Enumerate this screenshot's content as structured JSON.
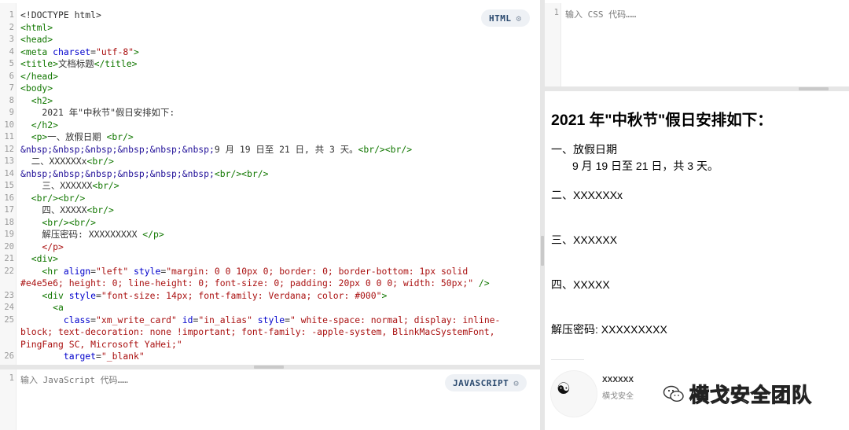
{
  "html_editor": {
    "badge": "HTML",
    "lines": [
      {
        "n": "1",
        "segs": [
          {
            "t": "<!DOCTYPE html>",
            "c": "t-txt"
          }
        ]
      },
      {
        "n": "2",
        "segs": [
          {
            "t": "<html>",
            "c": "t-tag"
          }
        ]
      },
      {
        "n": "3",
        "segs": [
          {
            "t": "<head>",
            "c": "t-tag"
          }
        ]
      },
      {
        "n": "4",
        "segs": [
          {
            "t": "<meta ",
            "c": "t-tag"
          },
          {
            "t": "charset",
            "c": "t-attr"
          },
          {
            "t": "=",
            "c": "t-txt"
          },
          {
            "t": "\"utf-8\"",
            "c": "t-str"
          },
          {
            "t": ">",
            "c": "t-tag"
          }
        ]
      },
      {
        "n": "5",
        "segs": [
          {
            "t": "<title>",
            "c": "t-tag"
          },
          {
            "t": "文档标题",
            "c": "t-txt"
          },
          {
            "t": "</title>",
            "c": "t-tag"
          }
        ]
      },
      {
        "n": "6",
        "segs": [
          {
            "t": "</head>",
            "c": "t-tag"
          }
        ]
      },
      {
        "n": "7",
        "segs": [
          {
            "t": "<body>",
            "c": "t-tag"
          }
        ]
      },
      {
        "n": "8",
        "segs": [
          {
            "t": "  <h2>",
            "c": "t-tag"
          }
        ]
      },
      {
        "n": "9",
        "segs": [
          {
            "t": "    2021 年\"中秋节\"假日安排如下:",
            "c": "t-txt"
          }
        ]
      },
      {
        "n": "10",
        "segs": [
          {
            "t": "  </h2>",
            "c": "t-tag"
          }
        ]
      },
      {
        "n": "11",
        "segs": [
          {
            "t": "  <p>",
            "c": "t-tag"
          },
          {
            "t": "一、放假日期 ",
            "c": "t-txt"
          },
          {
            "t": "<br/>",
            "c": "t-tag"
          }
        ]
      },
      {
        "n": "12",
        "segs": [
          {
            "t": "&nbsp;&nbsp;&nbsp;&nbsp;&nbsp;&nbsp;",
            "c": "t-ent"
          },
          {
            "t": "9 月 19 日至 21 日, 共 3 天。",
            "c": "t-txt"
          },
          {
            "t": "<br/><br/>",
            "c": "t-tag"
          }
        ]
      },
      {
        "n": "13",
        "segs": [
          {
            "t": "  二、XXXXXXx",
            "c": "t-txt"
          },
          {
            "t": "<br/>",
            "c": "t-tag"
          }
        ]
      },
      {
        "n": "14",
        "segs": [
          {
            "t": "&nbsp;&nbsp;&nbsp;&nbsp;&nbsp;&nbsp;",
            "c": "t-ent"
          },
          {
            "t": "<br/><br/>",
            "c": "t-tag"
          }
        ]
      },
      {
        "n": "15",
        "segs": [
          {
            "t": "    三、XXXXXX",
            "c": "t-txt"
          },
          {
            "t": "<br/>",
            "c": "t-tag"
          }
        ]
      },
      {
        "n": "16",
        "segs": [
          {
            "t": "  <br/><br/>",
            "c": "t-tag"
          }
        ]
      },
      {
        "n": "17",
        "segs": [
          {
            "t": "    四、XXXXX",
            "c": "t-txt"
          },
          {
            "t": "<br/>",
            "c": "t-tag"
          }
        ]
      },
      {
        "n": "18",
        "segs": [
          {
            "t": "    <br/><br/>",
            "c": "t-tag"
          }
        ]
      },
      {
        "n": "19",
        "segs": [
          {
            "t": "    解压密码: XXXXXXXXX ",
            "c": "t-txt"
          },
          {
            "t": "</p>",
            "c": "t-tag"
          }
        ]
      },
      {
        "n": "20",
        "segs": [
          {
            "t": "    </p>",
            "c": "t-str"
          }
        ]
      },
      {
        "n": "21",
        "segs": [
          {
            "t": "  <div>",
            "c": "t-tag"
          }
        ]
      },
      {
        "n": "22",
        "segs": [
          {
            "t": "    <hr ",
            "c": "t-tag"
          },
          {
            "t": "align",
            "c": "t-attr"
          },
          {
            "t": "=",
            "c": "t-txt"
          },
          {
            "t": "\"left\" ",
            "c": "t-str"
          },
          {
            "t": "style",
            "c": "t-attr"
          },
          {
            "t": "=",
            "c": "t-txt"
          },
          {
            "t": "\"margin: 0 0 10px 0; border: 0; border-bottom: 1px solid",
            "c": "t-str"
          }
        ]
      },
      {
        "n": "",
        "segs": [
          {
            "t": "#e4e5e6; height: 0; line-height: 0; font-size: 0; padding: 20px 0 0 0; width: 50px;\" ",
            "c": "t-str"
          },
          {
            "t": "/>",
            "c": "t-tag"
          }
        ]
      },
      {
        "n": "23",
        "segs": [
          {
            "t": "    <div ",
            "c": "t-tag"
          },
          {
            "t": "style",
            "c": "t-attr"
          },
          {
            "t": "=",
            "c": "t-txt"
          },
          {
            "t": "\"font-size: 14px; font-family: Verdana; color: #000\"",
            "c": "t-str"
          },
          {
            "t": ">",
            "c": "t-tag"
          }
        ]
      },
      {
        "n": "24",
        "segs": [
          {
            "t": "      <a",
            "c": "t-tag"
          }
        ]
      },
      {
        "n": "25",
        "segs": [
          {
            "t": "        ",
            "c": "t-txt"
          },
          {
            "t": "class",
            "c": "t-attr"
          },
          {
            "t": "=",
            "c": "t-txt"
          },
          {
            "t": "\"xm_write_card\" ",
            "c": "t-str"
          },
          {
            "t": "id",
            "c": "t-attr"
          },
          {
            "t": "=",
            "c": "t-txt"
          },
          {
            "t": "\"in_alias\" ",
            "c": "t-str"
          },
          {
            "t": "style",
            "c": "t-attr"
          },
          {
            "t": "=",
            "c": "t-txt"
          },
          {
            "t": "\" white-space: normal; display: inline-",
            "c": "t-str"
          }
        ]
      },
      {
        "n": "",
        "segs": [
          {
            "t": "block; text-decoration: none !important; font-family: -apple-system, BlinkMacSystemFont,",
            "c": "t-str"
          }
        ]
      },
      {
        "n": "",
        "segs": [
          {
            "t": "PingFang SC, Microsoft YaHei;\"",
            "c": "t-str"
          }
        ]
      },
      {
        "n": "26",
        "segs": [
          {
            "t": "        ",
            "c": "t-txt"
          },
          {
            "t": "target",
            "c": "t-attr"
          },
          {
            "t": "=",
            "c": "t-txt"
          },
          {
            "t": "\"_blank\"",
            "c": "t-str"
          }
        ]
      }
    ]
  },
  "js_editor": {
    "badge": "JAVASCRIPT",
    "line_no": "1",
    "placeholder": "输入 JavaScript 代码……"
  },
  "css_editor": {
    "line_no": "1",
    "placeholder": "输入 CSS 代码……"
  },
  "preview": {
    "heading": "2021 年\"中秋节\"假日安排如下：",
    "item1_title": "一、放假日期",
    "item1_detail": "9 月 19 日至 21 日，共 3 天。",
    "item2": "二、XXXXXXx",
    "item3": "三、XXXXXX",
    "item4": "四、XXXXX",
    "password": "解压密码: XXXXXXXXX",
    "card_name": "XXXXXX",
    "card_sub": "横戈安全",
    "watermark": "横戈安全团队"
  }
}
